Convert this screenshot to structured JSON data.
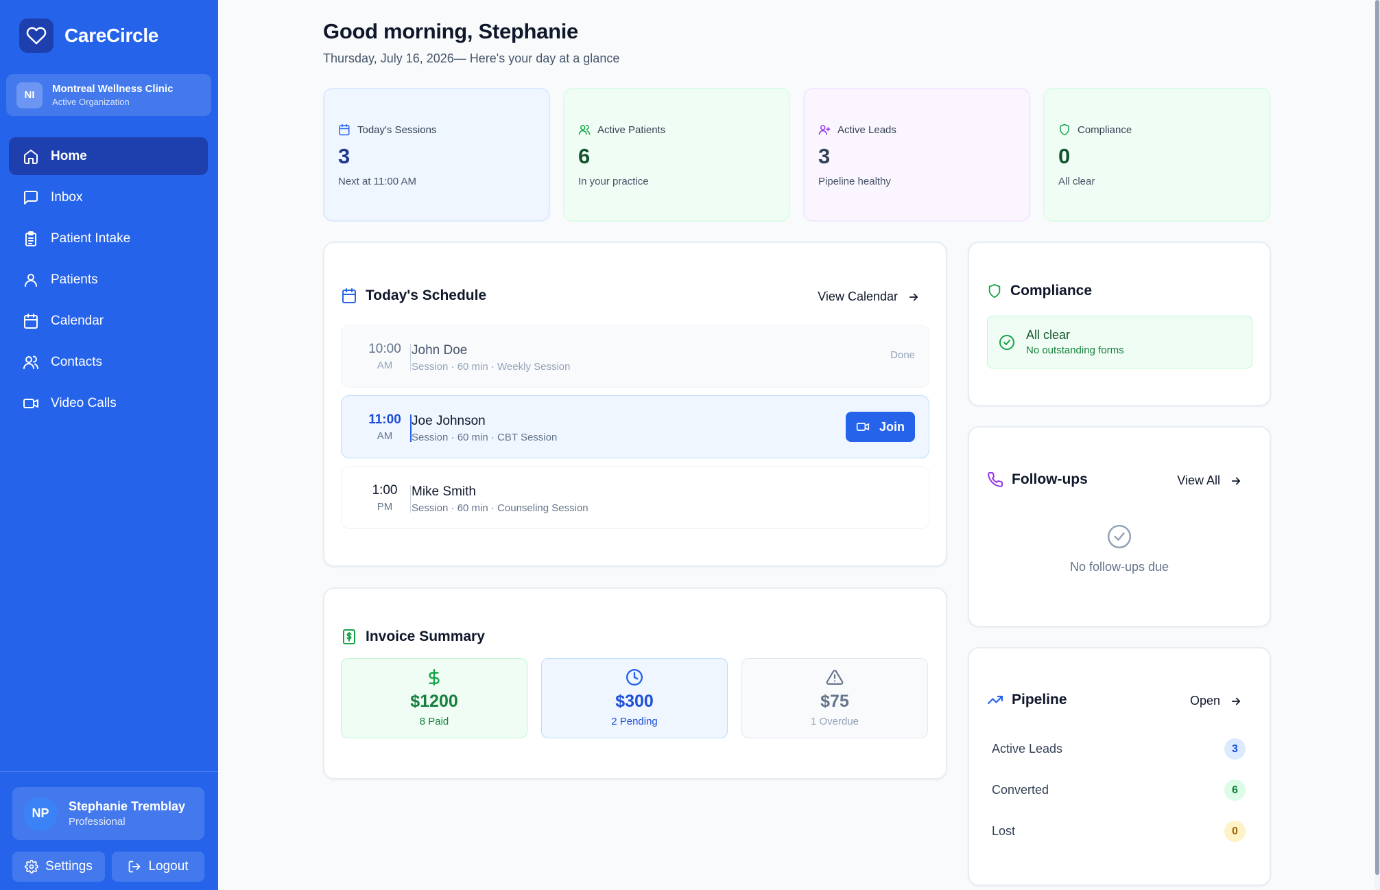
{
  "brand": {
    "name": "CareCircle",
    "icon": "heart-icon"
  },
  "org": {
    "initials": "NI",
    "name": "Montreal Wellness Clinic",
    "status": "Active Organization"
  },
  "nav": [
    {
      "label": "Home",
      "icon": "home-icon",
      "active": true
    },
    {
      "label": "Inbox",
      "icon": "message-icon"
    },
    {
      "label": "Patient Intake",
      "icon": "clipboard-icon"
    },
    {
      "label": "Patients",
      "icon": "user-icon"
    },
    {
      "label": "Calendar",
      "icon": "calendar-icon"
    },
    {
      "label": "Contacts",
      "icon": "users-icon"
    },
    {
      "label": "Video Calls",
      "icon": "video-icon"
    }
  ],
  "user": {
    "initials": "NP",
    "name": "Stephanie Tremblay",
    "role": "Professional"
  },
  "footer": {
    "settings_label": "Settings",
    "logout_label": "Logout"
  },
  "header": {
    "greeting": "Good morning, Stephanie",
    "subtitle": "Thursday, July 16, 2026— Here's your day at a glance"
  },
  "stats": [
    {
      "label": "Today's Sessions",
      "value": "3",
      "sub": "Next at 11:00 AM",
      "icon": "calendar-icon",
      "color": "#1e3a8a",
      "icon_color": "#2563eb"
    },
    {
      "label": "Active Patients",
      "value": "6",
      "sub": "In your practice",
      "icon": "users-icon",
      "color": "#14532d",
      "icon_color": "#16a34a"
    },
    {
      "label": "Active Leads",
      "value": "3",
      "sub": "Pipeline healthy",
      "icon": "user-plus-icon",
      "color": "#4c1d95",
      "icon_color": "#9333ea"
    },
    {
      "label": "Compliance",
      "value": "0",
      "sub": "All clear",
      "icon": "shield-icon",
      "color": "#14532d",
      "icon_color": "#16a34a"
    }
  ],
  "schedule": {
    "title": "Today's Schedule",
    "link": "View Calendar",
    "sessions": [
      {
        "time": "10:00",
        "period": "AM",
        "name": "John Doe",
        "meta": "Session · 60 min · Weekly Session",
        "status": "Done"
      },
      {
        "time": "11:00",
        "period": "AM",
        "name": "Joe Johnson",
        "meta": "Session · 60 min · CBT Session",
        "action": "Join"
      },
      {
        "time": "1:00",
        "period": "PM",
        "name": "Mike Smith",
        "meta": "Session · 60 min · Counseling Session"
      }
    ]
  },
  "invoice": {
    "title": "Invoice Summary",
    "items": [
      {
        "amount": "$1200",
        "label": "8 Paid",
        "icon": "dollar-icon"
      },
      {
        "amount": "$300",
        "label": "2 Pending",
        "icon": "clock-icon"
      },
      {
        "amount": "$75",
        "label": "1 Overdue",
        "icon": "alert-triangle-icon"
      }
    ]
  },
  "compliance": {
    "title": "Compliance",
    "status": "All clear",
    "detail": "No outstanding forms"
  },
  "followups": {
    "title": "Follow-ups",
    "link": "View All",
    "empty": "No follow-ups due"
  },
  "pipeline": {
    "title": "Pipeline",
    "link": "Open",
    "rows": [
      {
        "label": "Active Leads",
        "count": "3"
      },
      {
        "label": "Converted",
        "count": "6"
      },
      {
        "label": "Lost",
        "count": "0"
      }
    ]
  },
  "colors": {
    "primary": "#2563eb",
    "sidebar_active": "#1e40af",
    "success": "#16a34a",
    "warning": "#ca8a04"
  }
}
